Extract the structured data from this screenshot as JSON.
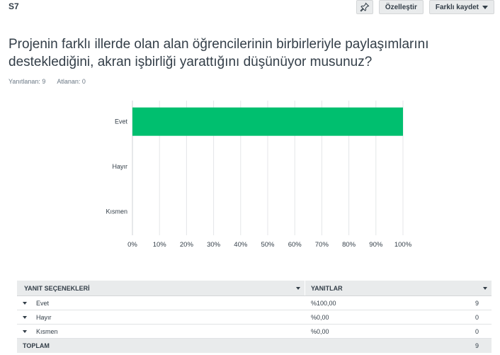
{
  "question_number": "S7",
  "toolbar": {
    "pin_icon": "pin-icon",
    "customize_label": "Özelleştir",
    "save_as_label": "Farklı kaydet"
  },
  "question": {
    "text": "Projenin farklı illerde olan alan öğrencilerinin birbirleriyle paylaşımlarını desteklediğini, akran işbirliği yarattığını düşünüyor musunuz?",
    "answered": "Yanıtlanan: 9",
    "skipped": "Atlanan: 0"
  },
  "colors": {
    "bar": "#00bf6f",
    "grid": "#e4e6e8",
    "header_bg": "#e9ebec"
  },
  "chart_data": {
    "type": "bar",
    "orientation": "horizontal",
    "categories": [
      "Evet",
      "Hayır",
      "Kısmen"
    ],
    "values": [
      100,
      0,
      0
    ],
    "xticks": [
      "0%",
      "10%",
      "20%",
      "30%",
      "40%",
      "50%",
      "60%",
      "70%",
      "80%",
      "90%",
      "100%"
    ],
    "xlim": [
      0,
      100
    ],
    "grid": true
  },
  "table": {
    "col1_header": "YANIT SEÇENEKLERİ",
    "col2_header": "YANITLAR",
    "rows": [
      {
        "label": "Evet",
        "percent": "%100,00",
        "count": "9"
      },
      {
        "label": "Hayır",
        "percent": "%0,00",
        "count": "0"
      },
      {
        "label": "Kısmen",
        "percent": "%0,00",
        "count": "0"
      }
    ],
    "total_label": "TOPLAM",
    "total_count": "9"
  }
}
